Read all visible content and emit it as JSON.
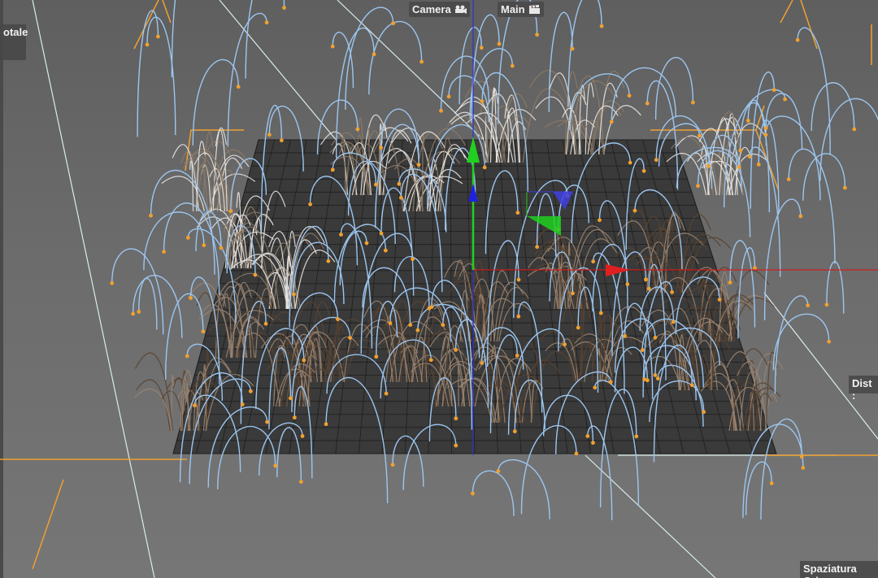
{
  "viewport": {
    "camera_label": "Camera",
    "take_label": "Main",
    "camera_icon": "film-camera-icon",
    "clapper_icon": "clapperboard-icon"
  },
  "hud": {
    "left_label": "otale",
    "right_label": "Dist :",
    "bottom_label": "Spaziatura Grig"
  },
  "colors": {
    "background": "#6a6a6a",
    "grid_floor": "#3c3c3c",
    "guide_curve": "#9cc6f0",
    "curve_tip": "#f0a030",
    "camera_frame": "#f0a030",
    "axis_x": "#e02020",
    "axis_y": "#20d020",
    "axis_z": "#2020e0"
  }
}
